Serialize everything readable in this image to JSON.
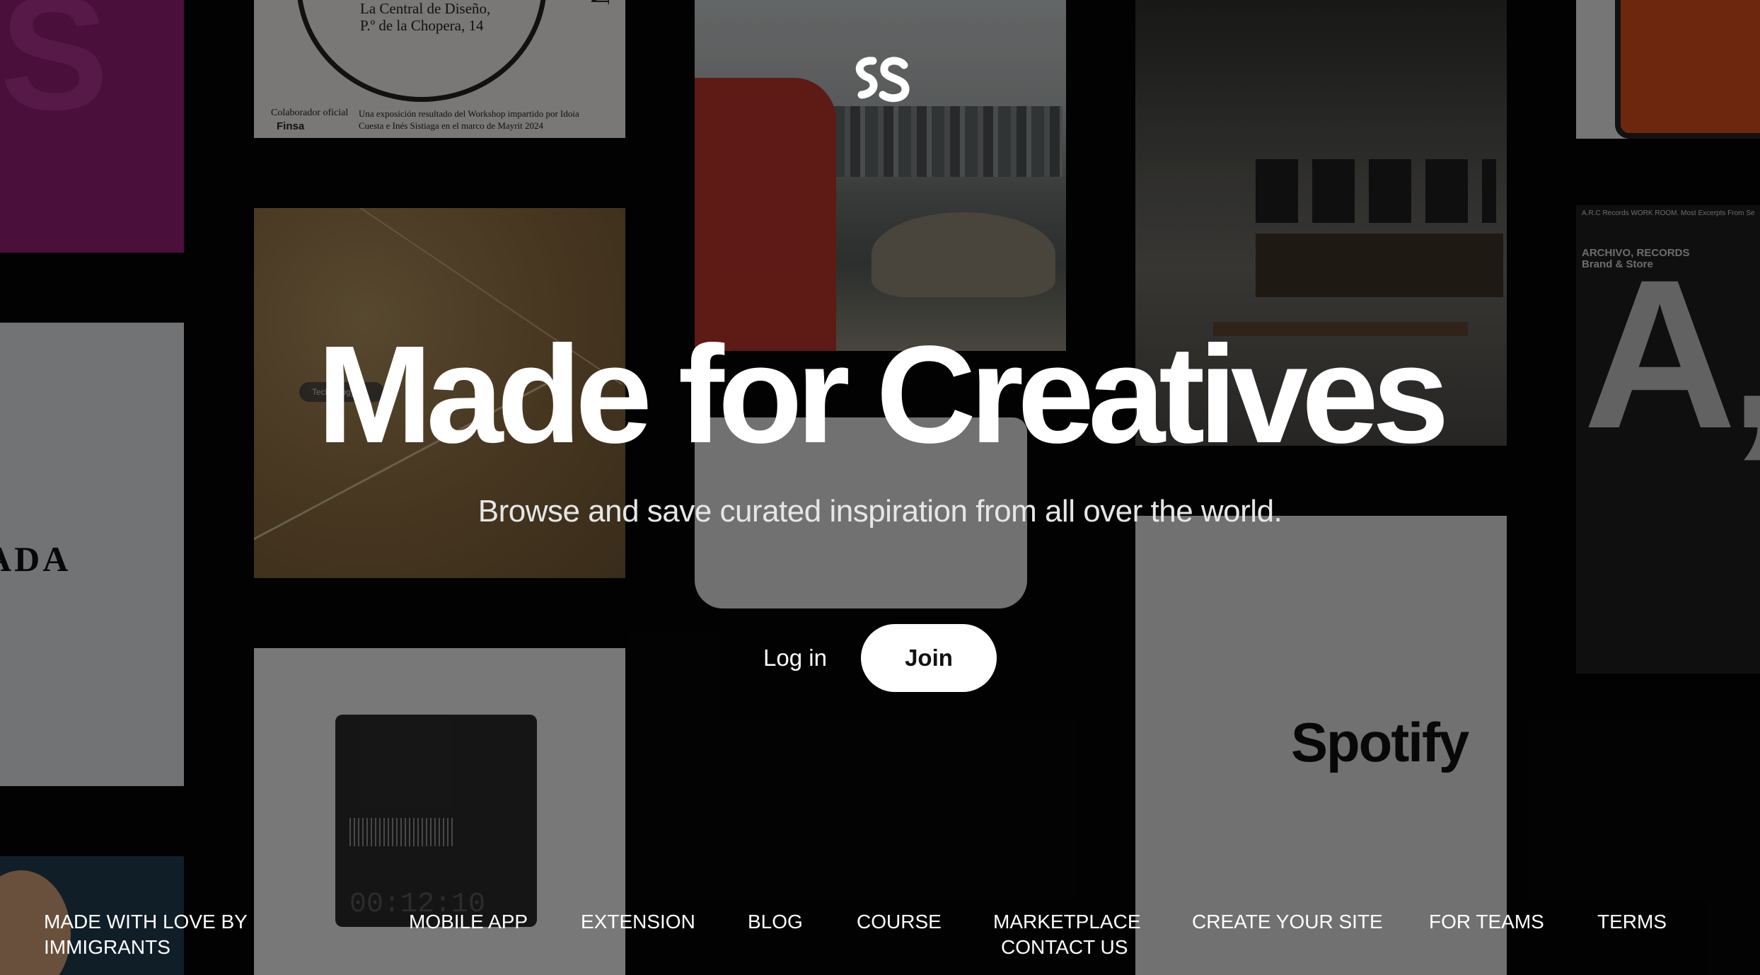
{
  "brand": {
    "logo_icon": "ss-monogram-icon"
  },
  "hero": {
    "headline": "Made for Creatives",
    "subtitle": "Browse and save curated inspiration from all over the world."
  },
  "auth": {
    "login_label": "Log in",
    "join_label": "Join"
  },
  "footer": {
    "tagline_line1": "MADE WITH LOVE BY",
    "tagline_line2": "IMMIGRANTS",
    "links": [
      "MOBILE APP",
      "EXTENSION",
      "BLOG",
      "COURSE",
      "MARKETPLACE",
      "CONTACT US",
      "CREATE YOUR SITE",
      "FOR TEAMS",
      "TERMS"
    ]
  },
  "background_tiles": {
    "poster": {
      "address_line1": "La Central de Diseño,",
      "address_line2": "P.º de la Chopera, 14",
      "vertical_word": "MACIÓN",
      "collab_label": "Colaborador oficial",
      "sponsor": "Finsa",
      "note": "Una exposición resultado del Workshop impartido por Idoia Cuesta e Inés Sistiaga en el marco de Mayrit 2024"
    },
    "sand_pill": "Technology",
    "spotify_word": "Spotify",
    "archivo": {
      "top_line": "A.R.C Records WORK ROOM. Most Excerpts From Se",
      "title": "ARCHIVO, RECORDS",
      "subtitle": "Brand & Store",
      "big_letters": "A,O"
    },
    "prada_word": "ADA",
    "recorder_time": "00:12:10"
  },
  "colors": {
    "background": "#050505",
    "text": "#ffffff",
    "join_bg": "#ffffff",
    "join_text": "#111111"
  }
}
